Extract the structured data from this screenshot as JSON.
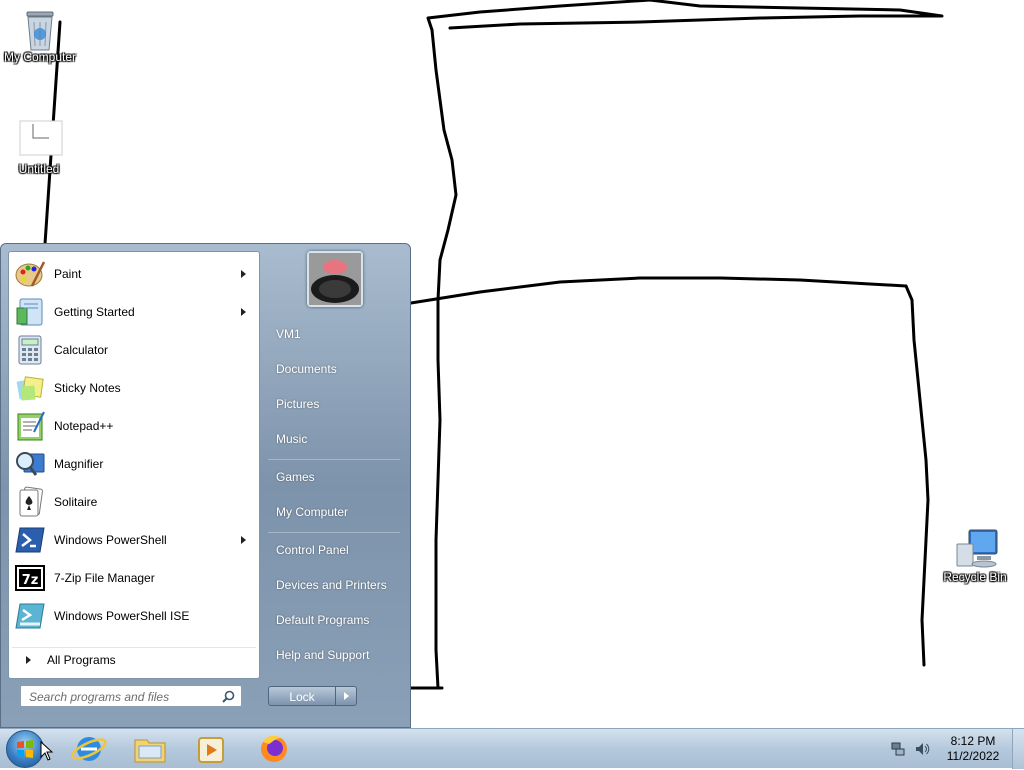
{
  "desktop": {
    "icons": [
      {
        "label": "My Computer",
        "icon": "recycle-bin-icon"
      },
      {
        "label": "Untitled",
        "icon": "image-file-icon"
      },
      {
        "label": "Recycle Bin",
        "icon": "computer-icon"
      }
    ]
  },
  "start_menu": {
    "programs": [
      {
        "label": "Paint",
        "icon": "paint-icon",
        "has_submenu": true
      },
      {
        "label": "Getting Started",
        "icon": "getting-started-icon",
        "has_submenu": true
      },
      {
        "label": "Calculator",
        "icon": "calculator-icon",
        "has_submenu": false
      },
      {
        "label": "Sticky Notes",
        "icon": "sticky-notes-icon",
        "has_submenu": false
      },
      {
        "label": "Notepad++",
        "icon": "notepadpp-icon",
        "has_submenu": false
      },
      {
        "label": "Magnifier",
        "icon": "magnifier-icon",
        "has_submenu": false
      },
      {
        "label": "Solitaire",
        "icon": "solitaire-icon",
        "has_submenu": false
      },
      {
        "label": "Windows PowerShell",
        "icon": "powershell-icon",
        "has_submenu": true
      },
      {
        "label": "7-Zip File Manager",
        "icon": "7zip-icon",
        "has_submenu": false
      },
      {
        "label": "Windows PowerShell ISE",
        "icon": "powershell-ise-icon",
        "has_submenu": false
      }
    ],
    "all_programs_label": "All Programs",
    "search_placeholder": "Search programs and files",
    "right_items": {
      "user": "VM1",
      "documents": "Documents",
      "pictures": "Pictures",
      "music": "Music",
      "games": "Games",
      "computer": "My Computer",
      "control_panel": "Control Panel",
      "devices": "Devices and Printers",
      "default_programs": "Default Programs",
      "help": "Help and Support"
    },
    "lock_label": "Lock"
  },
  "taskbar": {
    "pinned": [
      "internet-explorer-icon",
      "windows-explorer-icon",
      "media-player-icon",
      "firefox-icon"
    ],
    "clock_time": "8:12 PM",
    "clock_date": "11/2/2022"
  },
  "colors": {
    "start_menu_right": "#7d93ab",
    "taskbar": "#b5c9dd",
    "drawing_stroke": "#000000"
  }
}
